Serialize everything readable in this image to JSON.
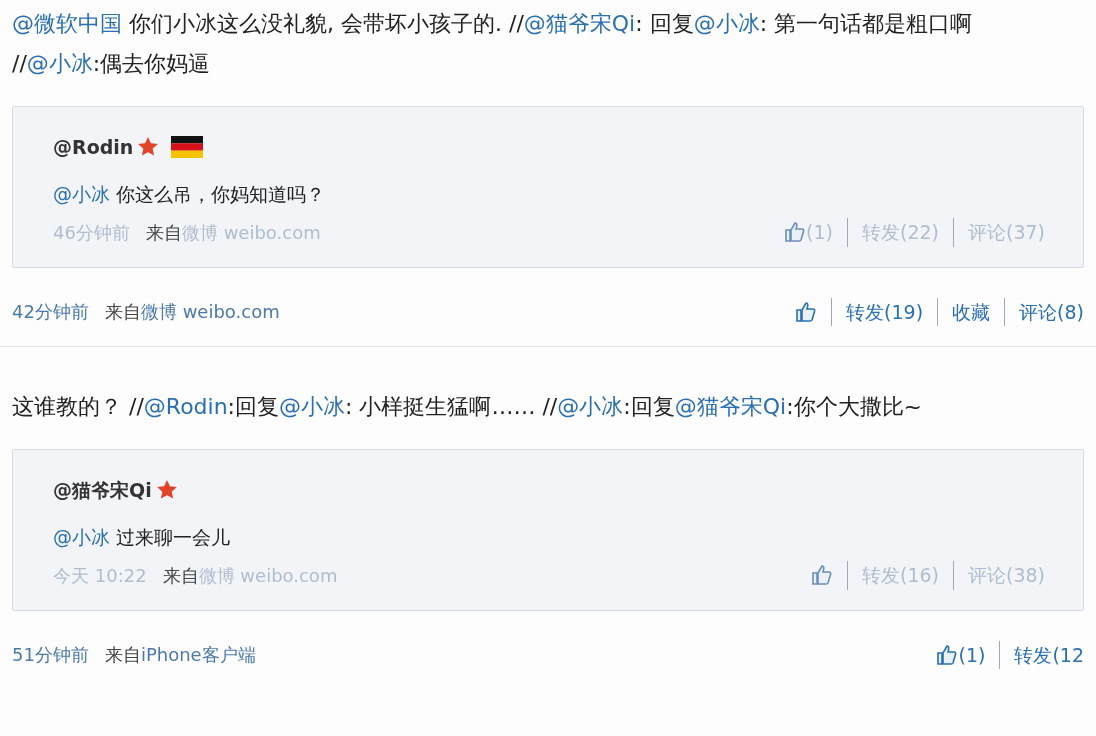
{
  "posts": [
    {
      "text": [
        {
          "kind": "link",
          "text": "@微软中国"
        },
        {
          "kind": "plain",
          "text": " 你们小冰这么没礼貌, 会带坏小孩子的. //"
        },
        {
          "kind": "link",
          "text": "@猫爷宋Qi"
        },
        {
          "kind": "plain",
          "text": ": 回复"
        },
        {
          "kind": "link",
          "text": "@小冰"
        },
        {
          "kind": "plain",
          "text": ": 第一句话都是粗口啊 //"
        },
        {
          "kind": "link",
          "text": "@小冰"
        },
        {
          "kind": "plain",
          "text": ":偶去你妈逼"
        }
      ],
      "quote": {
        "author": "@Rodin",
        "verified": true,
        "country_flag": true,
        "text": [
          {
            "kind": "link",
            "text": "@小冰"
          },
          {
            "kind": "plain",
            "text": " 你这么吊，你妈知道吗？"
          }
        ],
        "time": "46分钟前",
        "source_prefix": "来自",
        "source": "微博 weibo.com",
        "actions": [
          {
            "kind": "like",
            "label": "(1)"
          },
          {
            "kind": "text",
            "label": "转发(22)"
          },
          {
            "kind": "text",
            "label": "评论(37)"
          }
        ]
      },
      "time": "42分钟前",
      "source_prefix": "来自",
      "source": "微博 weibo.com",
      "actions": [
        {
          "kind": "like"
        },
        {
          "kind": "text",
          "label": "转发(19)"
        },
        {
          "kind": "text",
          "label": "收藏"
        },
        {
          "kind": "text",
          "label": "评论(8)"
        }
      ]
    },
    {
      "text": [
        {
          "kind": "plain",
          "text": "这谁教的？ //"
        },
        {
          "kind": "link",
          "text": "@Rodin"
        },
        {
          "kind": "plain",
          "text": ":回复"
        },
        {
          "kind": "link",
          "text": "@小冰"
        },
        {
          "kind": "plain",
          "text": ": 小样挺生猛啊…… //"
        },
        {
          "kind": "link",
          "text": "@小冰"
        },
        {
          "kind": "plain",
          "text": ":回复"
        },
        {
          "kind": "link",
          "text": "@猫爷宋Qi"
        },
        {
          "kind": "plain",
          "text": ":你个大撒比~"
        }
      ],
      "quote": {
        "author": "@猫爷宋Qi",
        "verified": true,
        "country_flag": false,
        "text": [
          {
            "kind": "link",
            "text": "@小冰"
          },
          {
            "kind": "plain",
            "text": " 过来聊一会儿"
          }
        ],
        "time": "今天 10:22",
        "source_prefix": "来自",
        "source": "微博 weibo.com",
        "actions": [
          {
            "kind": "like"
          },
          {
            "kind": "text",
            "label": "转发(16)"
          },
          {
            "kind": "text",
            "label": "评论(38)"
          }
        ]
      },
      "time": "51分钟前",
      "source_prefix": "来自",
      "source": "iPhone客户端",
      "actions": [
        {
          "kind": "like",
          "label": "(1)"
        },
        {
          "kind": "text",
          "label": "转发(12"
        }
      ]
    }
  ]
}
